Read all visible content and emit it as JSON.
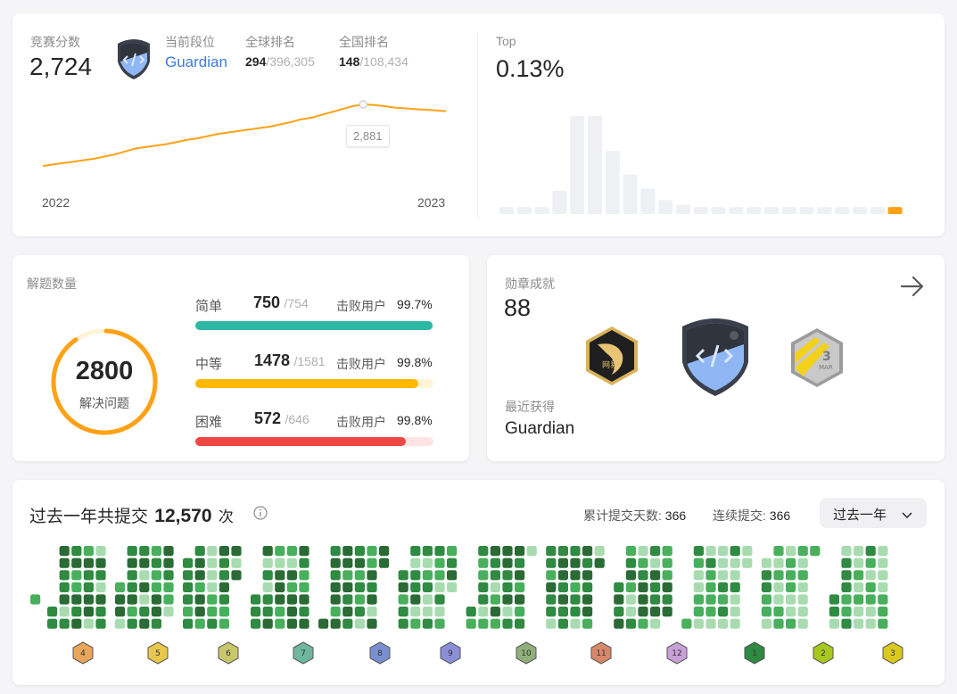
{
  "contest": {
    "rating_label": "竞赛分数",
    "rating_value": "2,724",
    "level_label": "当前段位",
    "level_value": "Guardian",
    "global_rank_label": "全球排名",
    "global_rank_value": "294",
    "global_rank_total": "/396,305",
    "national_rank_label": "全国排名",
    "national_rank_value": "148",
    "national_rank_total": "/108,434",
    "tooltip_value": "2,881",
    "year_start": "2022",
    "year_end": "2023",
    "top_label": "Top",
    "top_value": "0.13%",
    "accent_color": "#ffa116"
  },
  "chart_data": [
    {
      "type": "line",
      "title": "",
      "x": [
        "2022",
        "2023"
      ],
      "series": [
        {
          "values": [
            2460,
            2470,
            2480,
            2490,
            2500,
            2510,
            2525,
            2540,
            2560,
            2580,
            2590,
            2600,
            2610,
            2625,
            2640,
            2650,
            2665,
            2680,
            2690,
            2700,
            2710,
            2720,
            2730,
            2745,
            2760,
            2780,
            2790,
            2810,
            2830,
            2850,
            2870,
            2881,
            2878,
            2870,
            2860,
            2855,
            2850,
            2845,
            2840,
            2835
          ]
        }
      ],
      "tooltip": "2,881"
    },
    {
      "type": "bar",
      "title": "",
      "values": [
        3,
        3,
        3,
        10,
        42,
        42,
        27,
        17,
        11,
        6,
        4,
        3,
        3,
        3,
        3,
        3,
        3,
        3,
        3,
        3,
        3,
        3,
        3
      ],
      "highlight_index": 22
    }
  ],
  "solved": {
    "title": "解题数量",
    "total": "2800",
    "total_label": "解决问题",
    "beat_label": "击败用户",
    "rows": [
      {
        "label": "简单",
        "solved": "750",
        "total": "/754",
        "beat": "99.7%",
        "color": "#2db7a5",
        "track": "#e0f4f0",
        "fill": 0.995
      },
      {
        "label": "中等",
        "solved": "1478",
        "total": "/1581",
        "beat": "99.8%",
        "color": "#ffb800",
        "track": "#fff4d6",
        "fill": 0.935
      },
      {
        "label": "困难",
        "solved": "572",
        "total": "/646",
        "beat": "99.8%",
        "color": "#ef4743",
        "track": "#fde4e3",
        "fill": 0.885
      }
    ]
  },
  "badges": {
    "title": "勋章成就",
    "count": "88",
    "recent_label": "最近获得",
    "recent_value": "Guardian",
    "badge_left_text": "网易",
    "badge_right_num": "3",
    "badge_right_month": "MAR"
  },
  "submissions": {
    "title": "过去一年共提交",
    "count": "12,570",
    "unit": "次",
    "days_label": "累计提交天数:",
    "days_value": "366",
    "streak_label": "连续提交:",
    "streak_value": "366",
    "range_select": "过去一年",
    "months": [
      "4",
      "5",
      "6",
      "7",
      "8",
      "9",
      "10",
      "11",
      "12",
      "1",
      "2",
      "3"
    ]
  }
}
